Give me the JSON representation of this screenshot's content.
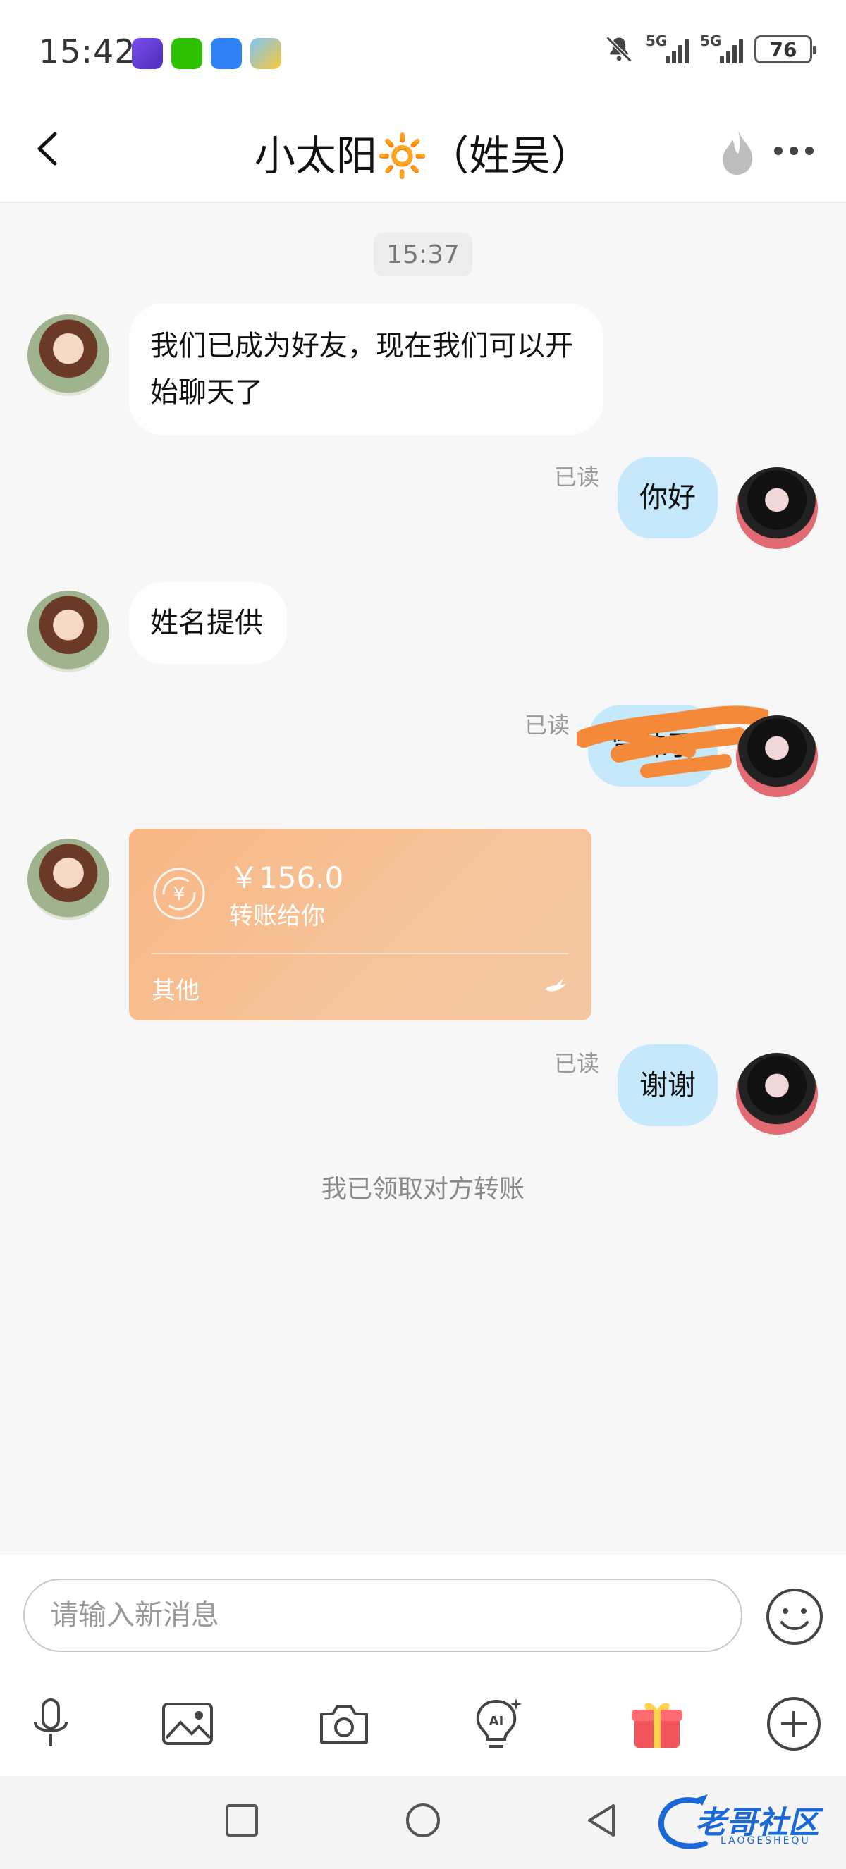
{
  "status_bar": {
    "time": "15:42",
    "network_1": "5G",
    "network_2": "5G",
    "battery": "76"
  },
  "header": {
    "title": "小太阳",
    "title_emoji": "🔆",
    "title_suffix": "（姓吴）"
  },
  "chat": {
    "timestamp": "15:37",
    "messages": [
      {
        "from": "them",
        "text": "我们已成为好友，现在我们可以开始聊天了"
      },
      {
        "from": "me",
        "text": "你好",
        "read": "已读"
      },
      {
        "from": "them",
        "text": "姓名提供"
      },
      {
        "from": "me",
        "text": "冒昧了",
        "read": "已读",
        "obscured": true
      },
      {
        "from": "them",
        "type": "transfer",
        "amount": "￥156.0",
        "desc": "转账给你",
        "footer": "其他"
      },
      {
        "from": "me",
        "text": "谢谢",
        "read": "已读"
      }
    ],
    "system_note": "我已领取对方转账"
  },
  "input": {
    "placeholder": "请输入新消息"
  },
  "toolbar": [
    "mic-icon",
    "image-icon",
    "camera-icon",
    "ai-bulb-icon",
    "gift-icon",
    "plus-icon"
  ],
  "watermark": {
    "text": "老哥社区",
    "sub": "LAOGESHEQU"
  },
  "colors": {
    "outgoing_bubble": "#c5e8fb",
    "incoming_bubble": "#ffffff",
    "transfer_card": "#f7bb88",
    "gift": "#f2545b"
  }
}
